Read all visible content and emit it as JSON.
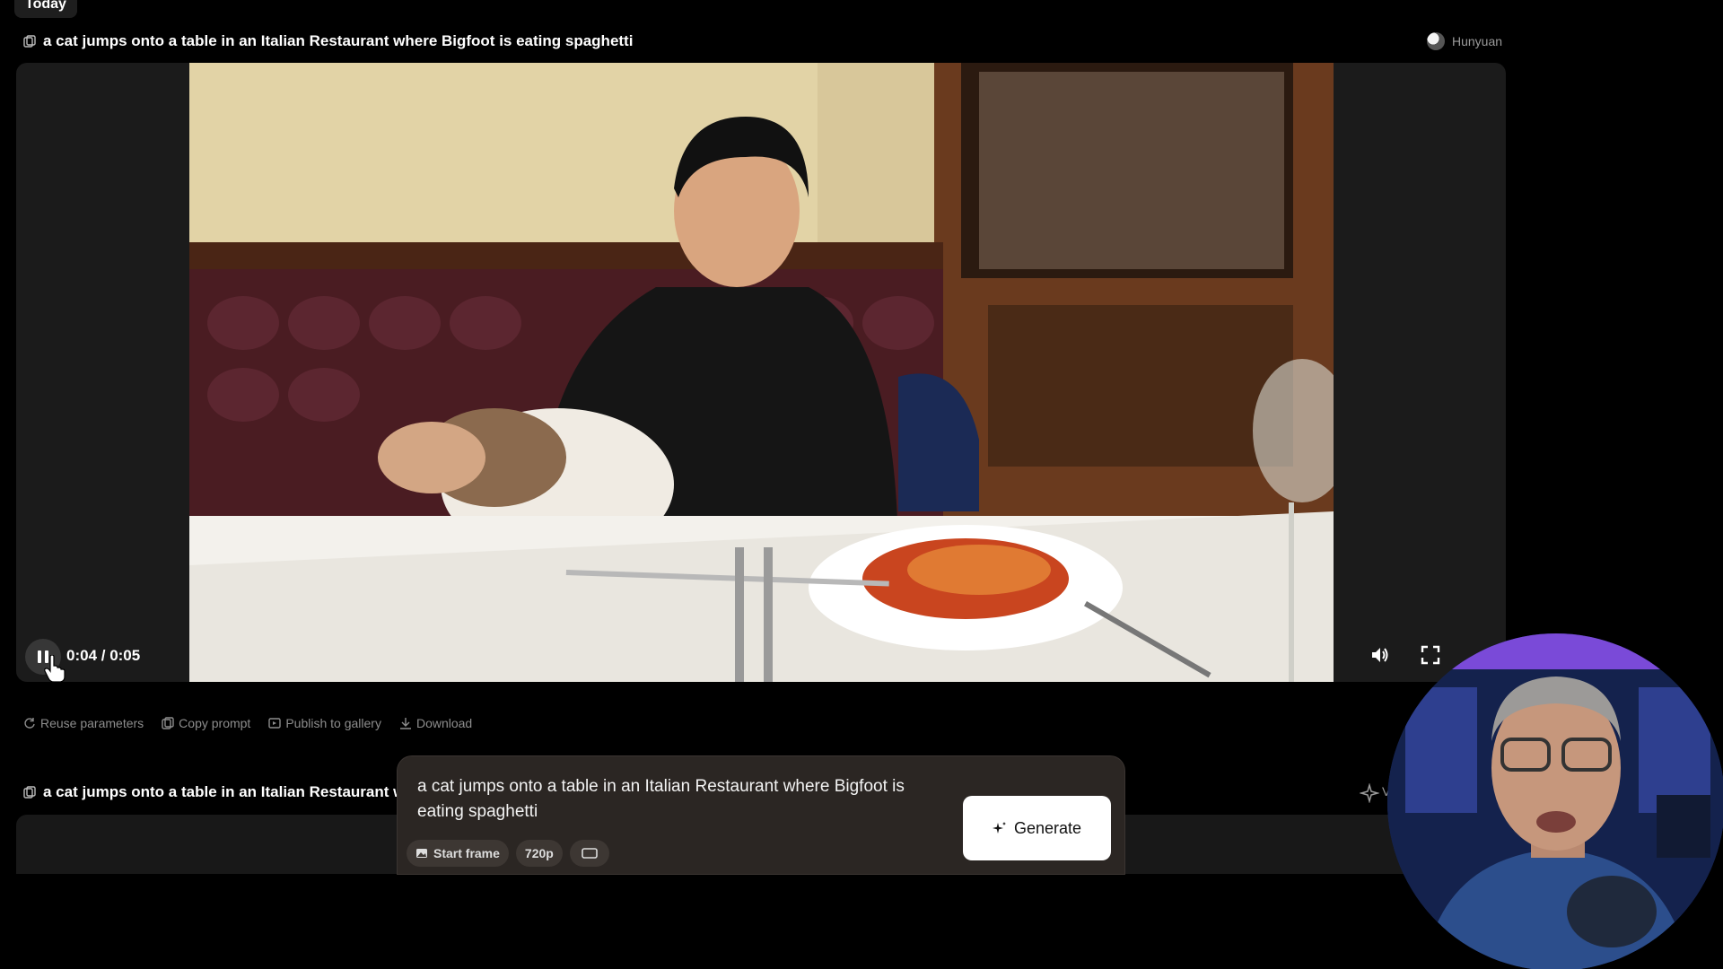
{
  "section": {
    "today_label": "Today"
  },
  "generation": {
    "title": "a cat jumps onto a table in an Italian Restaurant where Bigfoot is eating spaghetti",
    "model": "Hunyuan"
  },
  "player": {
    "time": "0:04 / 0:05",
    "progress": 0.8
  },
  "actions": {
    "reuse": "Reuse parameters",
    "copy": "Copy prompt",
    "publish": "Publish to gallery",
    "download": "Download"
  },
  "second_generation": {
    "title": "a cat jumps onto a table in an Italian Restaurant where Bigfoot is eating spaghetti",
    "model_partial": "V"
  },
  "composer": {
    "prompt": "a  cat jumps onto a table in an Italian Restaurant where Bigfoot is eating spaghetti",
    "start_frame_label": "Start frame",
    "resolution_label": "720p",
    "generate_label": "Generate"
  },
  "icons": {
    "copy": "copy-icon",
    "pause": "pause-icon",
    "volume": "volume-icon",
    "fullscreen": "fullscreen-icon",
    "reuse": "refresh-icon",
    "publish": "publish-icon",
    "download": "download-icon",
    "image": "image-icon",
    "aspect": "aspect-ratio-icon",
    "sparkle": "sparkle-icon"
  },
  "colors": {
    "background": "#000000",
    "card": "#1b1b1b",
    "composer": "#2b2623",
    "muted_text": "#8d8d8d"
  }
}
